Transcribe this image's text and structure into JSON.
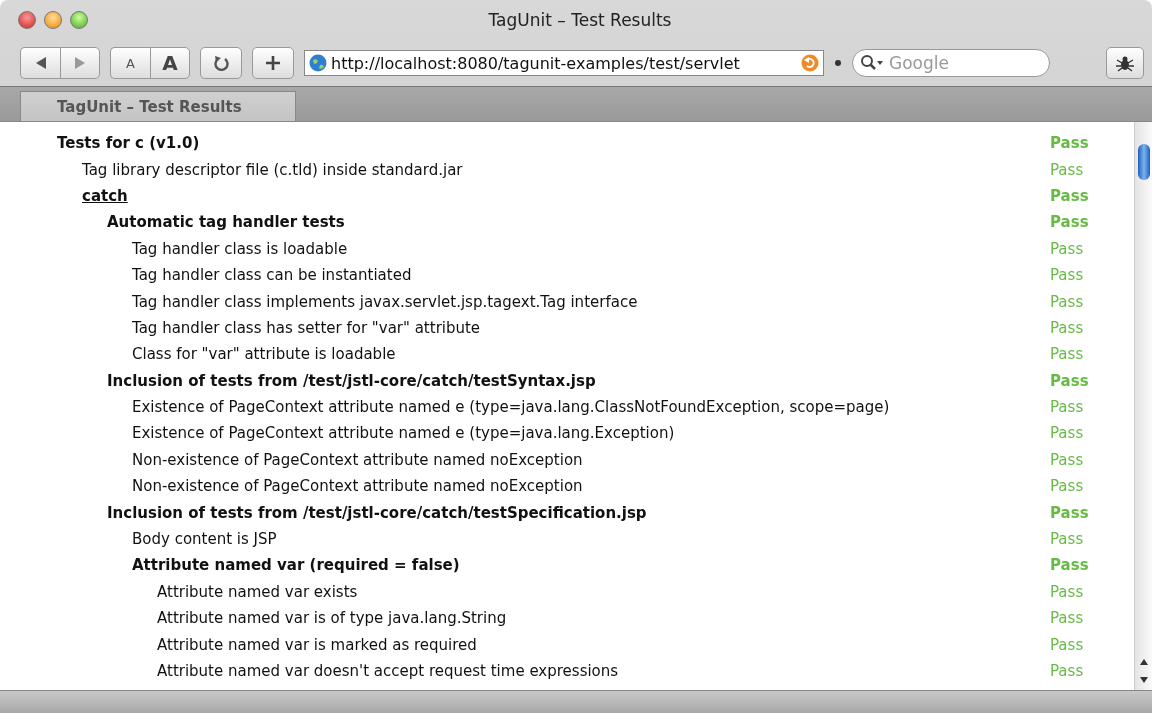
{
  "window": {
    "title": "TagUnit – Test Results"
  },
  "toolbar": {
    "text_smaller": "A",
    "text_bigger": "A",
    "url": "http://localhost:8080/tagunit-examples/test/servlet",
    "search": {
      "placeholder": "Google"
    }
  },
  "tabs": [
    {
      "label": "TagUnit – Test Results",
      "selected": true
    }
  ],
  "results": [
    {
      "kind": "group",
      "label": "Tests for c (v1.0)",
      "result": "Pass",
      "children": [
        {
          "kind": "test",
          "label": "Tag library descriptor file (c.tld) inside standard.jar",
          "result": "Pass"
        },
        {
          "kind": "link",
          "label": "catch",
          "result": "Pass",
          "children": [
            {
              "kind": "group",
              "label": "Automatic tag handler tests",
              "result": "Pass",
              "children": [
                {
                  "kind": "test",
                  "label": "Tag handler class is loadable",
                  "result": "Pass"
                },
                {
                  "kind": "test",
                  "label": "Tag handler class can be instantiated",
                  "result": "Pass"
                },
                {
                  "kind": "test",
                  "label": "Tag handler class implements javax.servlet.jsp.tagext.Tag interface",
                  "result": "Pass"
                },
                {
                  "kind": "test",
                  "label": "Tag handler class has setter for \"var\" attribute",
                  "result": "Pass"
                },
                {
                  "kind": "test",
                  "label": "Class for \"var\" attribute is loadable",
                  "result": "Pass"
                }
              ]
            },
            {
              "kind": "group",
              "label": "Inclusion of tests from /test/jstl-core/catch/testSyntax.jsp",
              "result": "Pass",
              "children": [
                {
                  "kind": "test",
                  "label": "Existence of PageContext attribute named e (type=java.lang.ClassNotFoundException, scope=page)",
                  "result": "Pass"
                },
                {
                  "kind": "test",
                  "label": "Existence of PageContext attribute named e (type=java.lang.Exception)",
                  "result": "Pass"
                },
                {
                  "kind": "test",
                  "label": "Non-existence of PageContext attribute named noException",
                  "result": "Pass"
                },
                {
                  "kind": "test",
                  "label": "Non-existence of PageContext attribute named noException",
                  "result": "Pass"
                }
              ]
            },
            {
              "kind": "group",
              "label": "Inclusion of tests from /test/jstl-core/catch/testSpecification.jsp",
              "result": "Pass",
              "children": [
                {
                  "kind": "test",
                  "label": "Body content is JSP",
                  "result": "Pass"
                },
                {
                  "kind": "group",
                  "label": "Attribute named var (required = false)",
                  "result": "Pass",
                  "children": [
                    {
                      "kind": "test",
                      "label": "Attribute named var exists",
                      "result": "Pass"
                    },
                    {
                      "kind": "test",
                      "label": "Attribute named var is of type java.lang.String",
                      "result": "Pass"
                    },
                    {
                      "kind": "test",
                      "label": "Attribute named var is marked as required",
                      "result": "Pass"
                    },
                    {
                      "kind": "test",
                      "label": "Attribute named var doesn't accept request time expressions",
                      "result": "Pass"
                    }
                  ]
                }
              ]
            }
          ]
        }
      ]
    }
  ]
}
